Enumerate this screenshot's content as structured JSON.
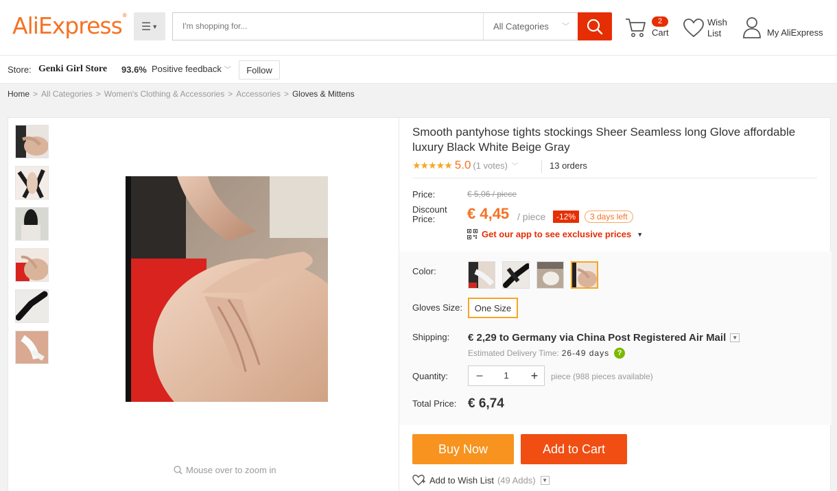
{
  "header": {
    "logo": "AliExpress",
    "logo_tm": "®",
    "search_placeholder": "I'm shopping for...",
    "search_category": "All Categories",
    "cart_count": "2",
    "cart_label": "Cart",
    "wish_label_1": "Wish",
    "wish_label_2": "List",
    "account_label": "My AliExpress"
  },
  "store": {
    "prefix": "Store:",
    "name": "Genki Girl Store",
    "rating": "93.6%",
    "feedback_label": "Positive feedback",
    "follow_label": "Follow"
  },
  "breadcrumb": {
    "items": [
      "Home",
      "All Categories",
      "Women's Clothing & Accessories",
      "Accessories",
      "Gloves & Mittens"
    ],
    "separator": ">"
  },
  "gallery": {
    "zoom_hint": "Mouse over to zoom in"
  },
  "product": {
    "title": "Smooth pantyhose tights stockings Sheer Seamless long Glove affordable luxury Black White Beige Gray",
    "stars": "★★★★★",
    "rating": "5.0",
    "votes": "(1 votes)",
    "orders": "13 orders",
    "price_label": "Price:",
    "old_price": "€ 5,06 / piece",
    "discount_label": "Discount Price:",
    "price": "€ 4,45",
    "per_piece": "/ piece",
    "discount_badge": "-12%",
    "days_left": "3 days left",
    "app_promo": "Get our app to see exclusive prices",
    "color_label": "Color:",
    "size_label": "Gloves Size:",
    "size_value": "One Size",
    "shipping_label": "Shipping:",
    "shipping_text": "€ 2,29 to Germany via China Post Registered Air Mail",
    "delivery_label": "Estimated Delivery Time:",
    "delivery_days": "26-49 days",
    "quantity_label": "Quantity:",
    "quantity": "1",
    "qty_unit": "piece",
    "qty_available": "(988 pieces available)",
    "total_label": "Total Price:",
    "total": "€ 6,74",
    "buy_now": "Buy Now",
    "add_to_cart": "Add to Cart",
    "wishlist_label": "Add to Wish List",
    "wishlist_adds": "(49 Adds)"
  },
  "colors": {
    "accent": "#f57224",
    "red": "#e62e04",
    "buy_now": "#f7931e",
    "add_cart": "#f04e12",
    "selected_border": "#f5a623"
  },
  "selected_color_index": 3
}
